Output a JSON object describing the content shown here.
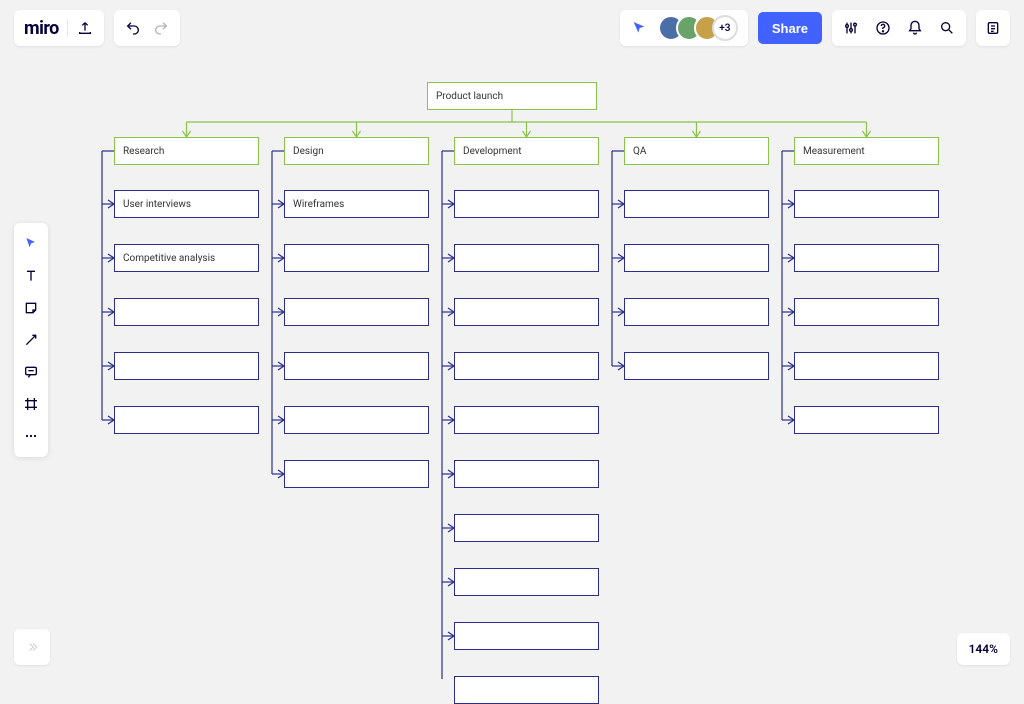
{
  "header": {
    "logo": "miro",
    "share_label": "Share",
    "extra_avatars": "+3"
  },
  "zoom": "144%",
  "diagram": {
    "root": "Product launch",
    "columns": [
      {
        "title": "Research",
        "items": [
          "User interviews",
          "Competitive analysis",
          "",
          "",
          ""
        ]
      },
      {
        "title": "Design",
        "items": [
          "Wireframes",
          "",
          "",
          "",
          "",
          ""
        ]
      },
      {
        "title": "Development",
        "items": [
          "",
          "",
          "",
          "",
          "",
          "",
          "",
          "",
          "",
          ""
        ]
      },
      {
        "title": "QA",
        "items": [
          "",
          "",
          "",
          ""
        ]
      },
      {
        "title": "Measurement",
        "items": [
          "",
          "",
          "",
          "",
          ""
        ]
      }
    ]
  }
}
